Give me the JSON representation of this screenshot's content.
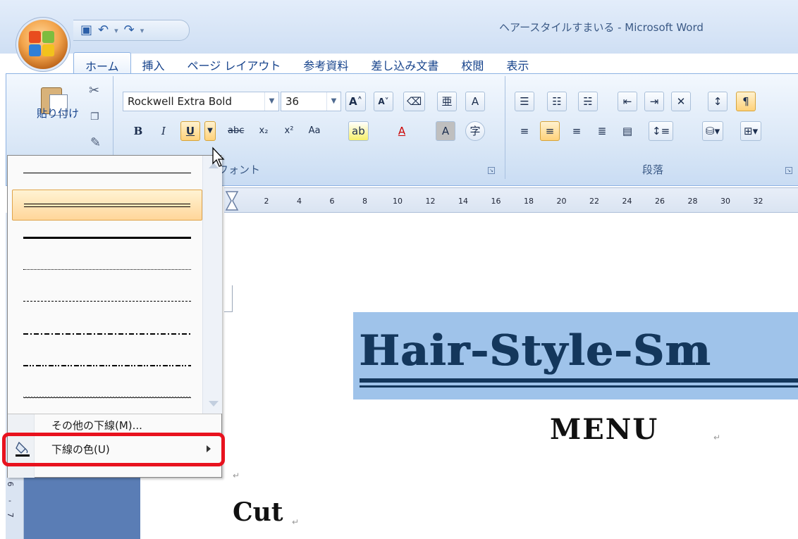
{
  "window": {
    "title": "ヘアースタイルすまいる - Microsoft Word"
  },
  "tabs": [
    "ホーム",
    "挿入",
    "ページ レイアウト",
    "参考資料",
    "差し込み文書",
    "校閲",
    "表示"
  ],
  "clipboard": {
    "paste_label": "貼り付け"
  },
  "font_group": {
    "font_name": "Rockwell Extra Bold",
    "font_size": "36",
    "label": "フォント",
    "bold": "B",
    "italic": "I",
    "underline": "U",
    "strike": "abc",
    "sub": "x₂",
    "sup": "x²",
    "case": "Aa",
    "grow": "A",
    "shrink": "A",
    "clear": "A",
    "border": "A",
    "enclose": "字",
    "color": "A"
  },
  "paragraph_group": {
    "label": "段落"
  },
  "ruler": {
    "numbers": [
      "2",
      "4",
      "6",
      "8",
      "10",
      "12",
      "14",
      "16",
      "18",
      "20",
      "22",
      "24",
      "26",
      "28",
      "30",
      "32"
    ]
  },
  "vruler": {
    "labels": [
      "6",
      "7"
    ]
  },
  "document": {
    "hero": "Hair-Style-Sm",
    "menu": "MENU",
    "cut": "Cut",
    "para_mark": "↵"
  },
  "underline_menu": {
    "styles": [
      "single",
      "double",
      "thick",
      "dotted",
      "dashed",
      "dash-dot",
      "dash-dot-dot",
      "wave"
    ],
    "selected_index": 1,
    "more_label": "その他の下線(M)...",
    "color_label": "下線の色(U)"
  },
  "colors": {
    "accent_red": "#e8121e",
    "hero_bg": "#9fc3ea",
    "hero_text": "#14375c",
    "margin_blue": "#5a7db5"
  }
}
